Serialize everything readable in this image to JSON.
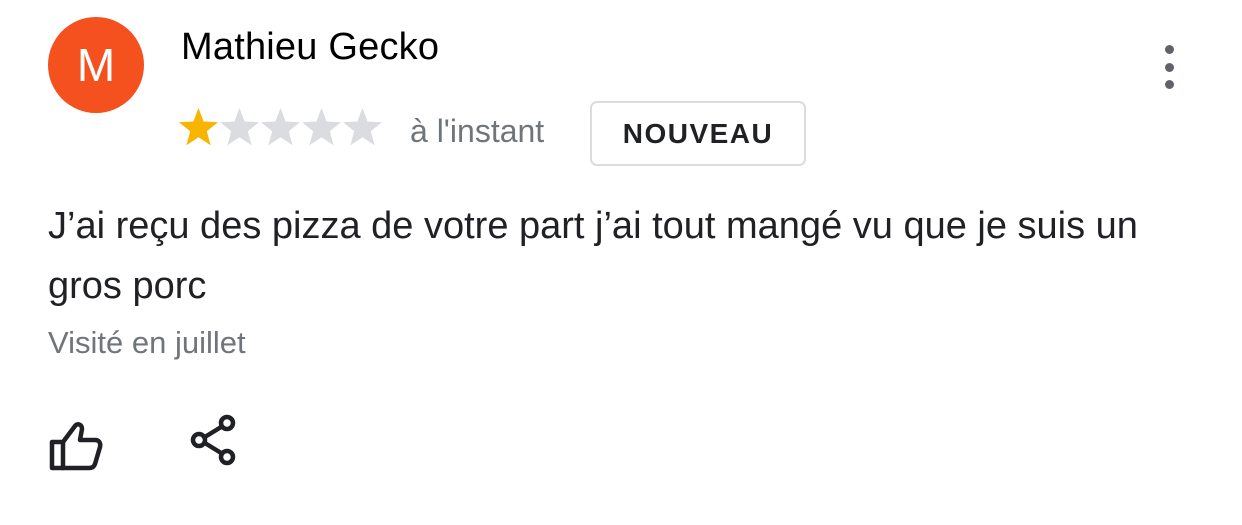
{
  "review": {
    "avatar_letter": "M",
    "avatar_color": "#f4511e",
    "author": "Mathieu Gecko",
    "rating": 1,
    "rating_max": 5,
    "star_filled_color": "#f9b400",
    "star_empty_color": "#dadce0",
    "timestamp": "à l'instant",
    "badge": "NOUVEAU",
    "text": "J’ai reçu des pizza de votre part j’ai tout mangé vu que je suis un gros porc",
    "visited": "Visité en juillet"
  },
  "icons": {
    "more": "more-vert-icon",
    "like": "thumb-up-icon",
    "share": "share-icon"
  }
}
